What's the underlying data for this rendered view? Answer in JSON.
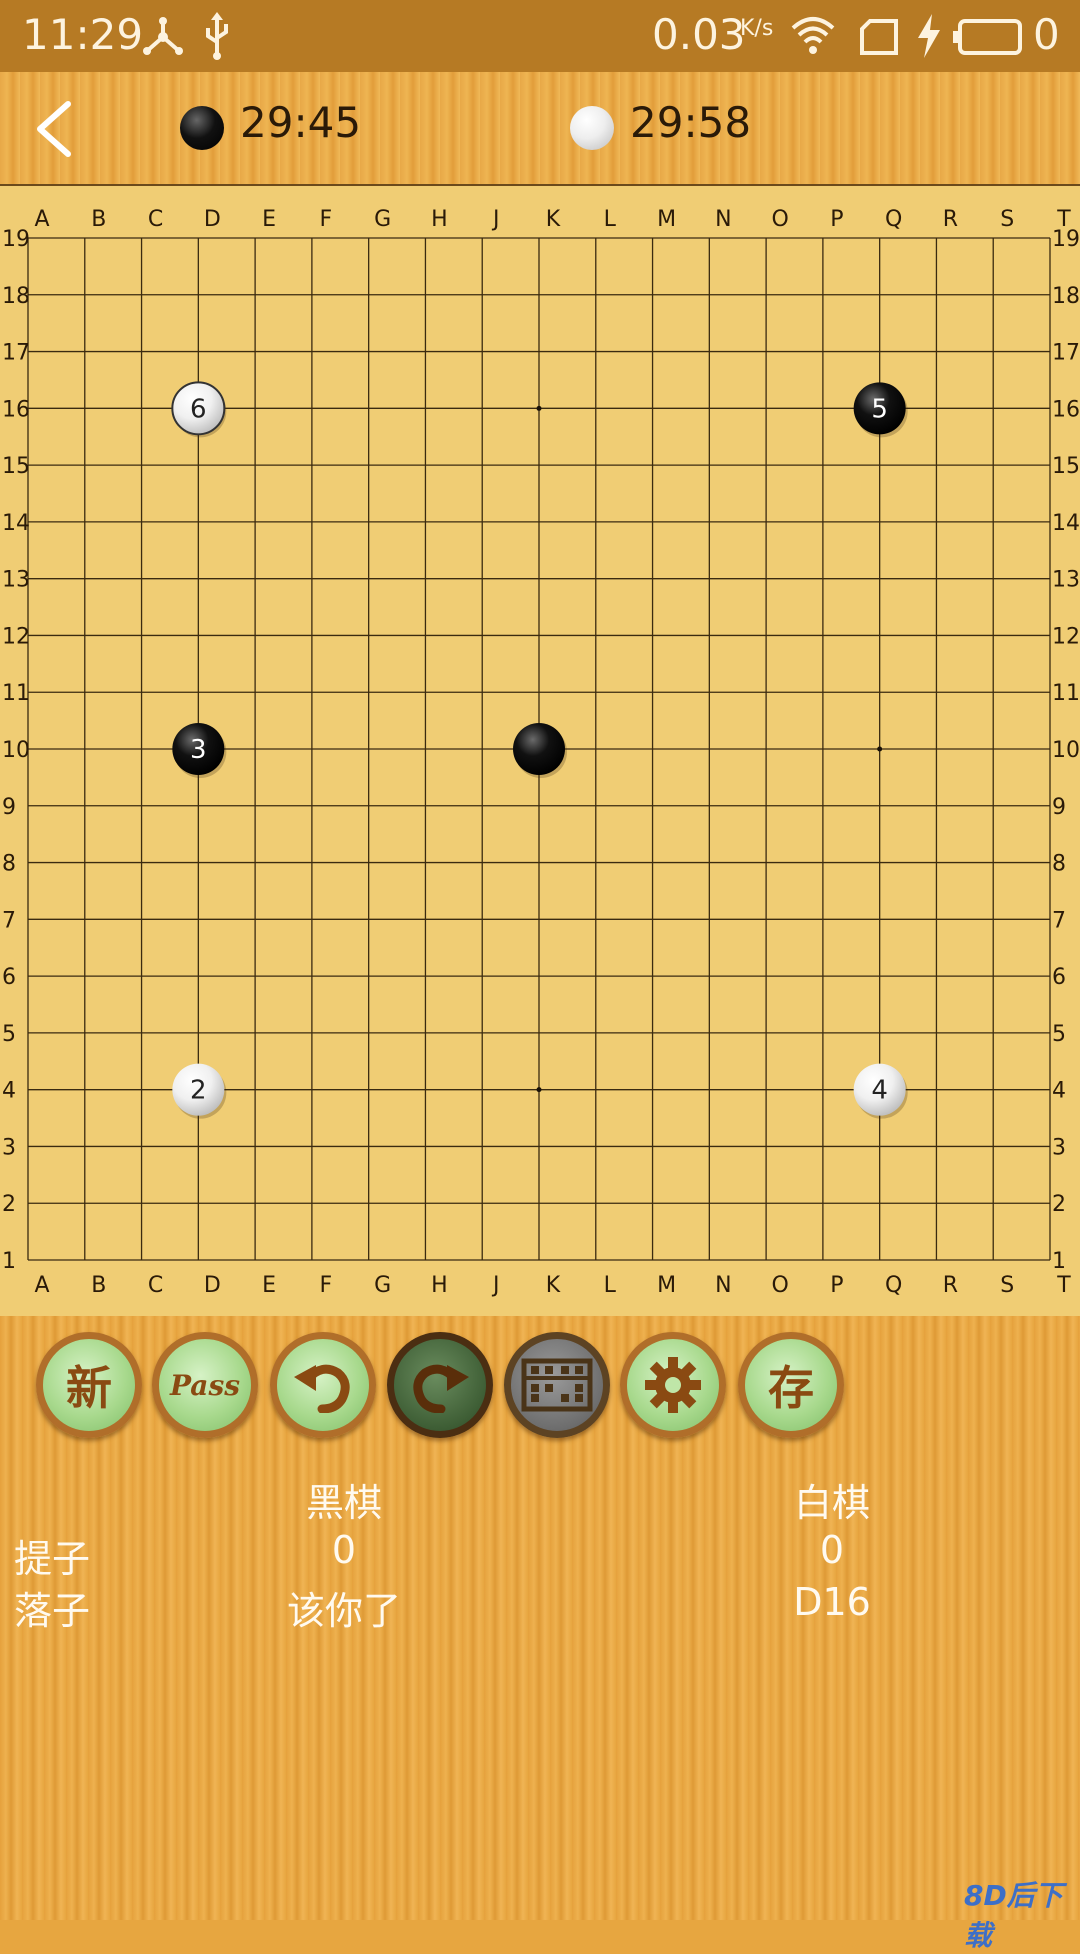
{
  "status_bar": {
    "time": "11:29",
    "speed": "0.03",
    "speed_unit": "K/s",
    "battery_level": "0",
    "icons": [
      "usb-tether-icon",
      "usb-icon",
      "wifi-icon",
      "sim-icon",
      "charging-icon",
      "battery-icon"
    ]
  },
  "header": {
    "back_icon": "chevron-left-icon",
    "black_timer": "29:45",
    "white_timer": "29:58"
  },
  "board": {
    "size": 19,
    "col_labels": [
      "A",
      "B",
      "C",
      "D",
      "E",
      "F",
      "G",
      "H",
      "J",
      "K",
      "L",
      "M",
      "N",
      "O",
      "P",
      "Q",
      "R",
      "S",
      "T"
    ],
    "row_labels": [
      "19",
      "18",
      "17",
      "16",
      "15",
      "14",
      "13",
      "12",
      "11",
      "10",
      "9",
      "8",
      "7",
      "6",
      "5",
      "4",
      "3",
      "2",
      "1"
    ],
    "star_points": [
      "D16",
      "K16",
      "Q16",
      "D10",
      "K10",
      "Q10",
      "D4",
      "K4",
      "Q4"
    ],
    "stones": [
      {
        "color": "white",
        "point": "D16",
        "move_number": "6"
      },
      {
        "color": "black",
        "point": "Q16",
        "move_number": "5"
      },
      {
        "color": "black",
        "point": "D10",
        "move_number": "3"
      },
      {
        "color": "black",
        "point": "K10",
        "move_number": ""
      },
      {
        "color": "white",
        "point": "D4",
        "move_number": "2"
      },
      {
        "color": "white",
        "point": "Q4",
        "move_number": "4"
      }
    ]
  },
  "toolbar": {
    "new_label": "新",
    "pass_label": "Pass",
    "save_label": "存",
    "icons": [
      "undo-icon",
      "redo-icon",
      "abacus-icon",
      "gear-icon"
    ]
  },
  "info": {
    "black_header": "黑棋",
    "white_header": "白棋",
    "captures_label": "提子",
    "black_captures": "0",
    "white_captures": "0",
    "move_label": "落子",
    "black_move": "该你了",
    "white_move": "D16"
  },
  "watermark": "8D后下载",
  "colors": {
    "board": "#f0cd74",
    "wood": "#e7a640",
    "status_bar": "#b67a24",
    "button_green": "#a8d98d",
    "button_rim": "#b06e2a"
  }
}
